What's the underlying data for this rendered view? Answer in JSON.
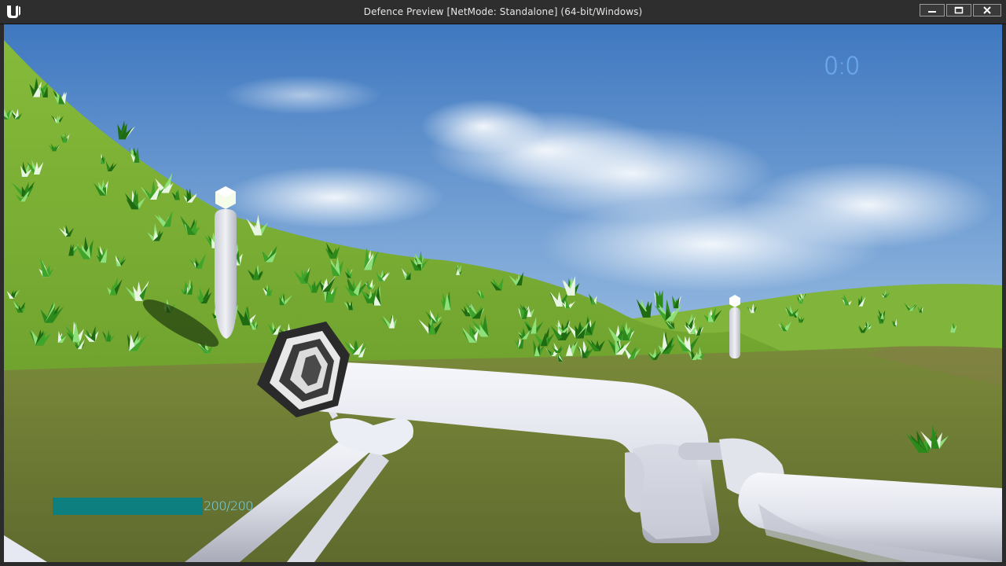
{
  "window": {
    "title": "Defence Preview [NetMode: Standalone]  (64-bit/Windows)",
    "logo_icon": "unreal-engine-logo-icon",
    "buttons": {
      "minimize_icon": "minimize-icon",
      "maximize_icon": "maximize-icon",
      "close_icon": "close-icon"
    }
  },
  "hud": {
    "score": "0:0",
    "health": {
      "text": "200/200",
      "current": 200,
      "max": 200,
      "bar_color": "#0c7f7e"
    }
  },
  "scene": {
    "sky_color": "#4a82c6",
    "grass_color": "#7fb336",
    "ground_color": "#6f7a35",
    "weapon_color": "#e7e9f2"
  }
}
